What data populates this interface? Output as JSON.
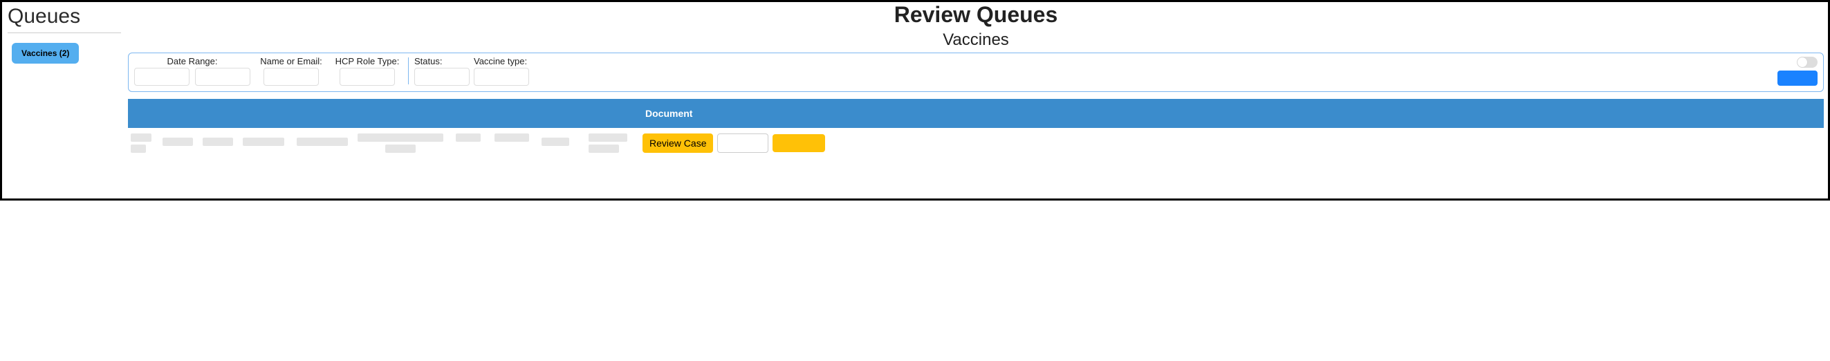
{
  "sidebar": {
    "title": "Queues",
    "items": [
      {
        "label": "Vaccines (2)"
      }
    ]
  },
  "page": {
    "title": "Review Queues",
    "subtitle": "Vaccines"
  },
  "filters": {
    "date_range": {
      "label": "Date Range:",
      "value": ""
    },
    "date_range2": {
      "value": ""
    },
    "name_email": {
      "label": "Name or Email:",
      "value": ""
    },
    "hcp_role": {
      "label": "HCP Role Type:",
      "value": ""
    },
    "status": {
      "label": "Status:",
      "value": ""
    },
    "vaccine_type": {
      "label": "Vaccine type:",
      "value": ""
    },
    "toggle_on": false,
    "apply_label": ""
  },
  "table": {
    "headers": [
      "",
      "",
      "",
      "",
      "",
      "",
      "",
      "",
      "",
      "",
      "Document",
      ""
    ],
    "rows": [
      {
        "review_label": "Review Case",
        "doc_value": "",
        "action_label": ""
      }
    ]
  }
}
